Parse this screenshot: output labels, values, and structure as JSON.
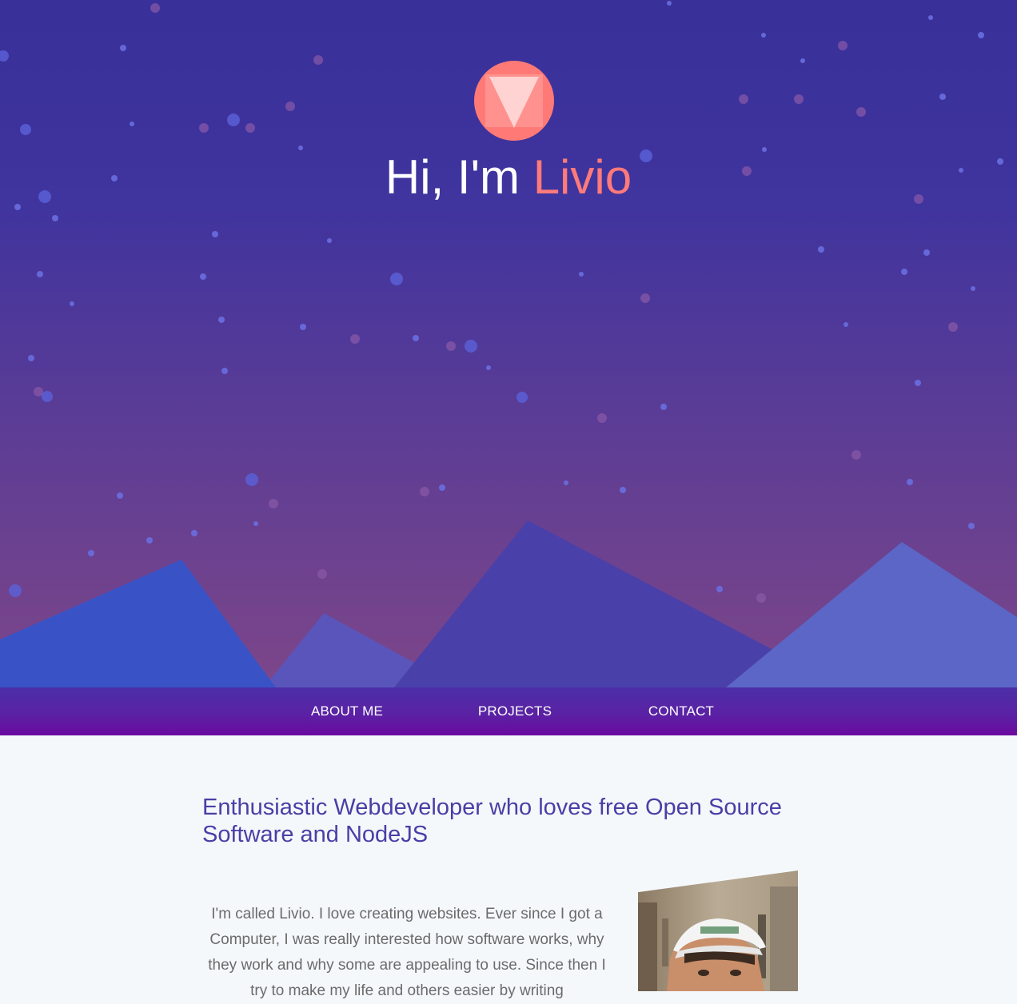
{
  "hero": {
    "logo_icon": "v-triangle-logo-icon",
    "greeting": "Hi, I'm ",
    "name": "Livio",
    "accent_color": "#ff7a7a"
  },
  "nav": {
    "items": [
      {
        "label": "ABOUT ME"
      },
      {
        "label": "PROJECTS"
      },
      {
        "label": "CONTACT"
      }
    ]
  },
  "about": {
    "tagline": "Enthusiastic Webdeveloper who loves free Open Source Software and NodeJS",
    "text": "I'm called Livio. I love creating websites. Ever since I got a Computer, I was really interested how software works, why they work and why some are appealing to use. Since then I try to make my life and others easier by writing",
    "photo": "profile-photo"
  }
}
